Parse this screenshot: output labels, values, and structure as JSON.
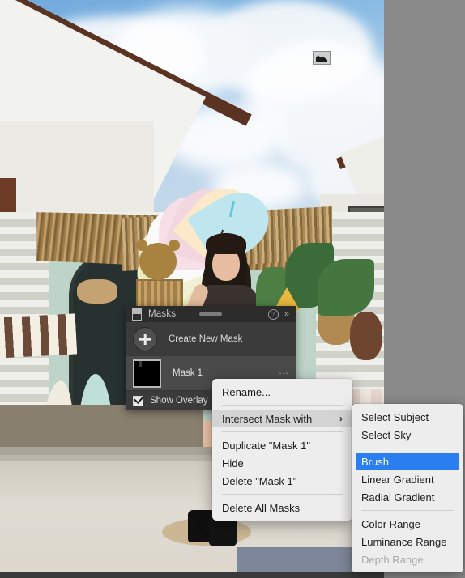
{
  "app": {
    "surface": "photo-editor-canvas",
    "photo_subject": "woman holding pastel umbrella in front of thatched-roof shop"
  },
  "photo_cursor": {
    "icon": "photo-badge-icon"
  },
  "masks_panel": {
    "title": "Masks",
    "icons": {
      "panel": "panel-toggle-icon",
      "grip": "drag-grip-icon",
      "help": "help-circle-icon",
      "collapse": "double-chevron-right-icon"
    },
    "create_new_mask": "Create New Mask",
    "plus_icon": "plus-icon",
    "mask_item": {
      "name": "Mask 1",
      "thumbnail": "mask-thumbnail",
      "more_icon": "ellipsis-icon"
    },
    "show_overlay": {
      "label": "Show Overlay",
      "checked": true
    }
  },
  "context_menu": {
    "items": [
      {
        "label": "Rename...",
        "type": "item",
        "state": "normal"
      },
      {
        "type": "separator"
      },
      {
        "label": "Intersect Mask with",
        "type": "submenu",
        "state": "highlighted",
        "arrow": "chevron-right-icon"
      },
      {
        "type": "separator"
      },
      {
        "label": "Duplicate \"Mask 1\"",
        "type": "item",
        "state": "normal"
      },
      {
        "label": "Hide",
        "type": "item",
        "state": "normal"
      },
      {
        "label": "Delete \"Mask 1\"",
        "type": "item",
        "state": "normal"
      },
      {
        "type": "separator"
      },
      {
        "label": "Delete All Masks",
        "type": "item",
        "state": "normal"
      }
    ]
  },
  "submenu": {
    "items": [
      {
        "label": "Select Subject",
        "type": "item",
        "state": "normal"
      },
      {
        "label": "Select Sky",
        "type": "item",
        "state": "normal"
      },
      {
        "type": "separator"
      },
      {
        "label": "Brush",
        "type": "item",
        "state": "selected"
      },
      {
        "label": "Linear Gradient",
        "type": "item",
        "state": "normal"
      },
      {
        "label": "Radial Gradient",
        "type": "item",
        "state": "normal"
      },
      {
        "type": "separator"
      },
      {
        "label": "Color Range",
        "type": "item",
        "state": "normal"
      },
      {
        "label": "Luminance Range",
        "type": "item",
        "state": "normal"
      },
      {
        "label": "Depth Range",
        "type": "item",
        "state": "disabled"
      }
    ]
  },
  "colors": {
    "panel_bg": "#3b3b3b",
    "panel_header_bg": "#2c2c2c",
    "menu_bg": "#eeedee",
    "selection_blue": "#2b7ef0",
    "hover_gray": "#d5d4d4",
    "canvas_gutter": "#8a8a8a"
  }
}
